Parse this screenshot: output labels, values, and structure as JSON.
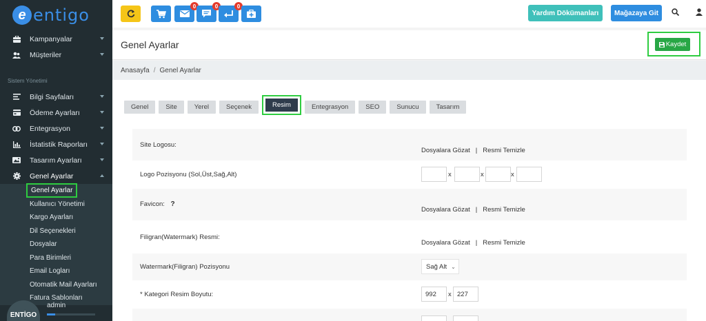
{
  "sidebar": {
    "logo_text": "entigo",
    "top_items": [
      {
        "label": "Kampanyalar",
        "icon": "briefcase-icon"
      },
      {
        "label": "Müşteriler",
        "icon": "users-icon"
      }
    ],
    "section_header": "Sistem Yönetimi",
    "items": [
      {
        "label": "Bilgi Sayfaları",
        "icon": "align-left-icon"
      },
      {
        "label": "Ödeme Ayarları",
        "icon": "credit-card-icon"
      },
      {
        "label": "Entegrasyon",
        "icon": "link-icon"
      },
      {
        "label": "İstatistik Raporları",
        "icon": "bar-chart-icon"
      },
      {
        "label": "Tasarım Ayarları",
        "icon": "image-icon"
      },
      {
        "label": "Genel Ayarlar",
        "icon": "cog-icon"
      }
    ],
    "submenu": [
      "Genel Ayarlar",
      "Kullanıcı Yönetimi",
      "Kargo Ayarları",
      "Dil Seçenekleri",
      "Dosyalar",
      "Para Birimleri",
      "Email Logları",
      "Otomatik Mail Ayarları",
      "Fatura Sablonları"
    ],
    "user": {
      "avatar_text": "ENTİGO",
      "name": "admin"
    }
  },
  "topbar": {
    "badges": {
      "mail": "0",
      "comments": "0",
      "returns": "0"
    },
    "help_label": "Yardım Dökümanları",
    "store_label": "Mağazaya Git"
  },
  "header": {
    "title": "Genel Ayarlar",
    "save_label": "Kaydet"
  },
  "breadcrumb": {
    "home": "Anasayfa",
    "current": "Genel Ayarlar"
  },
  "tabs": [
    "Genel",
    "Site",
    "Yerel",
    "Seçenek",
    "Resim",
    "Entegrasyon",
    "SEO",
    "Sunucu",
    "Tasarım"
  ],
  "active_tab": "Resim",
  "form": {
    "browse_label": "Dosyalara Gözat",
    "clear_label": "Resmi Temizle",
    "rows": {
      "site_logo": "Site Logosu:",
      "logo_position": "Logo Pozisyonu (Sol,Üst,Sağ,Alt)",
      "favicon": "Favicon:",
      "favicon_help": "?",
      "watermark_image": "Filigran(Watermark) Resmi:",
      "watermark_position": "Watermark(Filigran) Pozisyonu",
      "watermark_position_value": "Sağ Alt",
      "category_size": "* Kategori Resim Boyutu:",
      "category_width": "992",
      "category_height": "227"
    },
    "x_separator": "x"
  },
  "colors": {
    "sidebar_bg": "#222d32",
    "accent_blue": "#2e8de0",
    "save_green": "#28a745",
    "help_teal": "#3fc0ba",
    "highlight_green": "#2ecc40"
  }
}
